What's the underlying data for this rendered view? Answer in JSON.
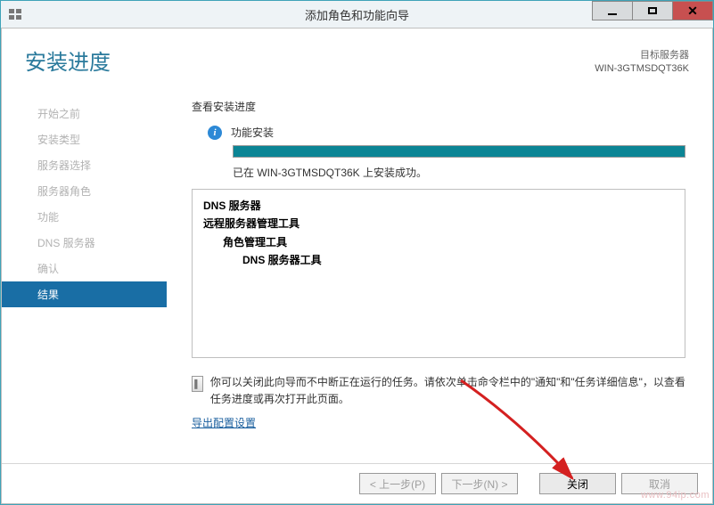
{
  "titlebar": {
    "title": "添加角色和功能向导"
  },
  "header": {
    "heading": "安装进度",
    "target_label": "目标服务器",
    "target_server": "WIN-3GTMSDQT36K"
  },
  "sidebar": {
    "steps": [
      "开始之前",
      "安装类型",
      "服务器选择",
      "服务器角色",
      "功能",
      "DNS 服务器",
      "确认",
      "结果"
    ],
    "current_index": 7
  },
  "main": {
    "section_title": "查看安装进度",
    "info_text": "功能安装",
    "status_line": "已在 WIN-3GTMSDQT36K 上安装成功。",
    "features": {
      "l1a": "DNS 服务器",
      "l1b": "远程服务器管理工具",
      "l2": "角色管理工具",
      "l3": "DNS 服务器工具"
    },
    "note_text": "你可以关闭此向导而不中断正在运行的任务。请依次单击命令栏中的\"通知\"和\"任务详细信息\"，以查看任务进度或再次打开此页面。",
    "export_link": "导出配置设置"
  },
  "footer": {
    "prev": "< 上一步(P)",
    "next": "下一步(N) >",
    "close": "关闭",
    "cancel": "取消"
  },
  "watermark": "www.94ip.com"
}
